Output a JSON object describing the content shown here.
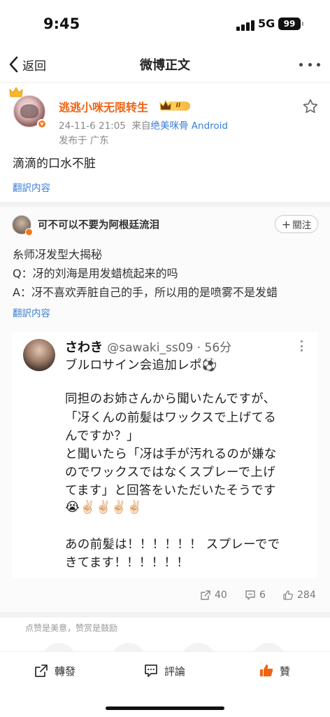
{
  "status_bar": {
    "time": "9:45",
    "network": "5G",
    "battery": "99"
  },
  "nav": {
    "back_label": "返回",
    "title": "微博正文"
  },
  "post": {
    "username": "逃逃小咪无限转生",
    "vip_level": "II",
    "timestamp": "24-11-6 21:05",
    "source_prefix": "来自",
    "source": "绝美咪骨 Android",
    "region": "发布于 广东",
    "text": "滴滴的口水不脏",
    "translate_label": "翻訳内容"
  },
  "repost": {
    "username": "可不可以不要为阿根廷流泪",
    "follow_label": "關注",
    "lines": [
      "糸师冴发型大揭秘",
      "Q：冴的刘海是用发蜡梳起来的吗",
      "A：冴不喜欢弄脏自己的手，所以用的是喷雾不是发蜡"
    ],
    "translate_label": "翻訳内容",
    "screenshot": {
      "name": "さわき",
      "handle": "@sawaki_ss09 · 56分",
      "lines": [
        "ブルロサイン会追加レポ⚽",
        "",
        "同担のお姉さんから聞いたんですが、",
        "「冴くんの前髪はワックスで上げてる",
        "んですか？」",
        "と聞いたら「冴は手が汚れるのが嫌な",
        "のでワックスではなくスプレーで上げ",
        "てます」と回答をいただいたそうです"
      ],
      "emoji_line": "😭✌🏻✌🏻✌🏻✌🏻",
      "tail_lines": [
        "あの前髪は！！！！！！ スプレーでで",
        "きてます！！！！！！"
      ]
    },
    "stats": {
      "reposts": "40",
      "comments": "6",
      "likes": "284"
    }
  },
  "like_note": "点赞是美意，赞赏是鼓励",
  "bottom_bar": {
    "repost_label": "轉發",
    "comment_label": "評論",
    "like_label": "贊"
  },
  "colors": {
    "accent_orange": "#f06414",
    "link_blue": "#3a7fd5",
    "like_orange": "#f06414"
  }
}
